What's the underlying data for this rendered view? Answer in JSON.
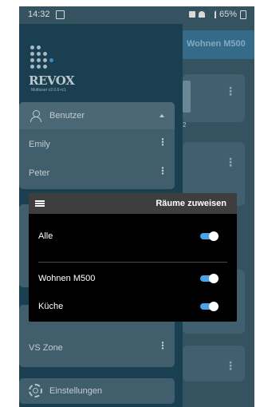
{
  "status_bar": {
    "time": "14:32",
    "battery": "65%"
  },
  "background_app": {
    "title": "Wohnen M500",
    "small_text": "2"
  },
  "drawer": {
    "logo": {
      "brand": "REVOX",
      "version": "Multiuser v2.0.6-rc1"
    },
    "users_panel": {
      "header": "Benutzer",
      "users": [
        {
          "name": "Emily"
        },
        {
          "name": "Peter"
        }
      ]
    },
    "zones_panel": {
      "items": [
        {
          "name": "VS Zone"
        }
      ]
    },
    "settings_label": "Einstellungen"
  },
  "dialog": {
    "title": "Räume zuweisen",
    "all": {
      "label": "Alle",
      "on": true
    },
    "rooms": [
      {
        "label": "Wohnen M500",
        "on": true
      },
      {
        "label": "Küche",
        "on": true
      }
    ]
  },
  "colors": {
    "toggle_on": "#4aa3e6",
    "drawer_bg": "#1f4a60",
    "panel_bg": "#4d6f80"
  }
}
